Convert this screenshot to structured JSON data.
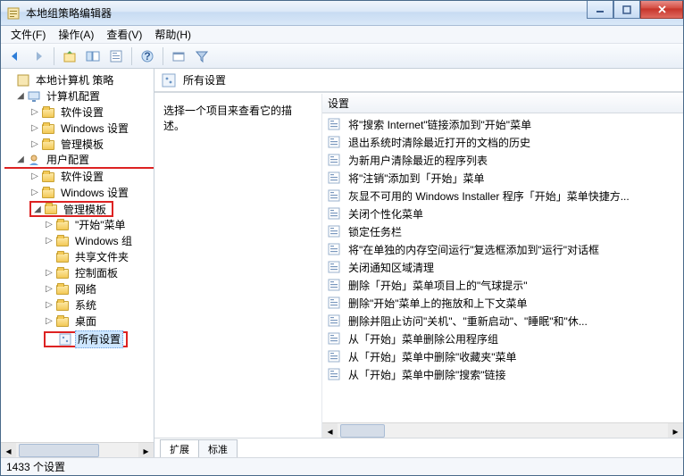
{
  "window": {
    "title": "本地组策略编辑器"
  },
  "menu": {
    "file": "文件(F)",
    "action": "操作(A)",
    "view": "查看(V)",
    "help": "帮助(H)"
  },
  "tree": {
    "root": "本地计算机 策略",
    "computer": {
      "label": "计算机配置",
      "children": [
        "软件设置",
        "Windows 设置",
        "管理模板"
      ]
    },
    "user": {
      "label": "用户配置",
      "soft": "软件设置",
      "win": "Windows 设置",
      "admin": {
        "label": "管理模板",
        "children": [
          "\"开始\"菜单",
          "Windows 组",
          "共享文件夹",
          "控制面板",
          "网络",
          "系统",
          "桌面"
        ],
        "allsettings": "所有设置"
      }
    }
  },
  "right": {
    "path": "所有设置",
    "desc": "选择一个项目来查看它的描述。",
    "header": "设置",
    "items": [
      "将\"搜索 Internet\"链接添加到\"开始\"菜单",
      "退出系统时清除最近打开的文档的历史",
      "为新用户清除最近的程序列表",
      "将\"注销\"添加到「开始」菜单",
      "灰显不可用的 Windows Installer 程序「开始」菜单快捷方...",
      "关闭个性化菜单",
      "锁定任务栏",
      "将\"在单独的内存空间运行\"复选框添加到\"运行\"对话框",
      "关闭通知区域清理",
      "删除「开始」菜单项目上的\"气球提示\"",
      "删除\"开始\"菜单上的拖放和上下文菜单",
      "删除并阻止访问\"关机\"、\"重新启动\"、\"睡眠\"和\"休...",
      "从「开始」菜单删除公用程序组",
      "从「开始」菜单中删除\"收藏夹\"菜单",
      "从「开始」菜单中删除\"搜索\"链接"
    ]
  },
  "tabs": {
    "ext": "扩展",
    "std": "标准"
  },
  "status": "1433 个设置"
}
